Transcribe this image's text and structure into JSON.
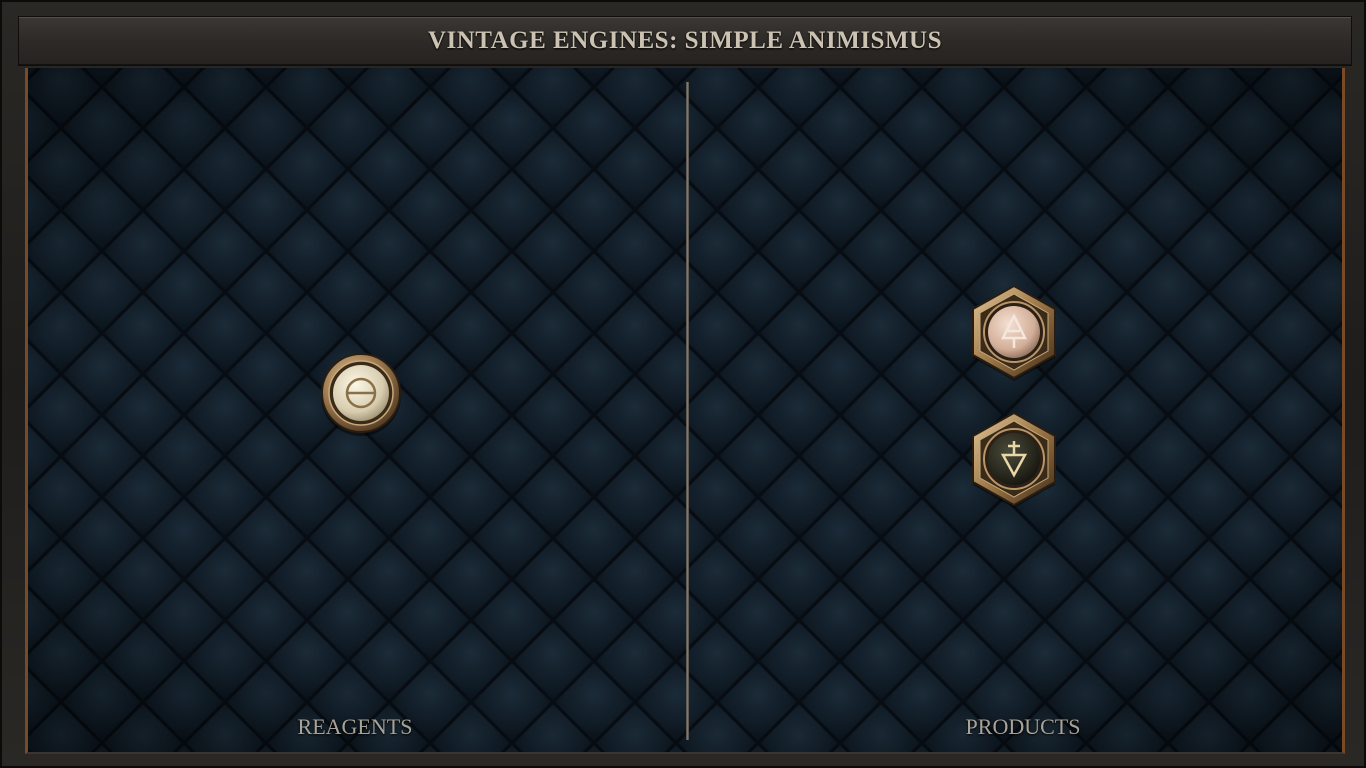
{
  "title": "VINTAGE ENGINES: SIMPLE ANIMISMUS",
  "panels": {
    "reagents_label": "REAGENTS",
    "products_label": "PRODUCTS"
  },
  "reagents": [
    {
      "icon": "salt-symbol-icon",
      "glyph": "⦵",
      "frame": "round",
      "fill": "#e6dcc2"
    }
  ],
  "products": [
    {
      "icon": "vitae-symbol-icon",
      "frame": "hexagon",
      "fill": "#e2c2b0"
    },
    {
      "icon": "mors-symbol-icon",
      "frame": "hexagon",
      "fill": "#2a2a22"
    }
  ],
  "colors": {
    "background": "#111c26",
    "accent_border": "#7a4a26",
    "title_text": "#cbc2b2",
    "label_text": "#a8a397",
    "brass": "#b08a5c"
  }
}
